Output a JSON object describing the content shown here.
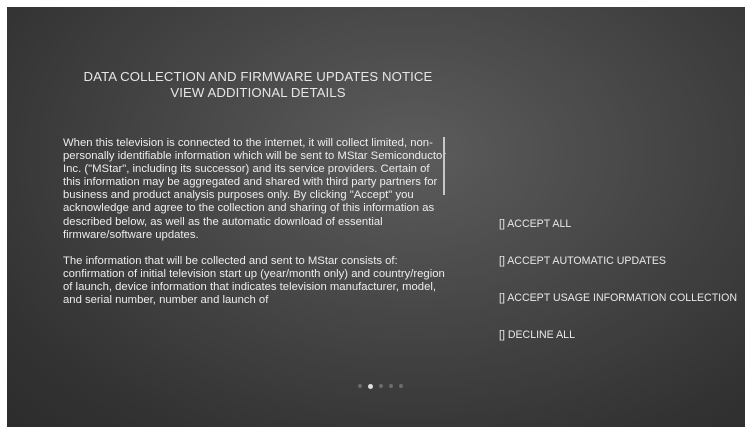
{
  "header": {
    "title_line1": "DATA COLLECTION AND FIRMWARE UPDATES NOTICE",
    "title_line2": "VIEW ADDITIONAL DETAILS"
  },
  "notice": {
    "paragraph1": "When this television is connected to the internet, it will collect limited, non-personally identifiable information which will be sent to MStar Semiconductor Inc. (\"MStar\", including its successor) and its service providers. Certain of this information may be aggregated and shared with third party partners for business and product analysis purposes only. By clicking \"Accept\" you acknowledge and agree to the collection and sharing of this information as described below, as well as the automatic download of essential firmware/software updates.",
    "paragraph2": "The information that will be collected and sent to MStar consists of: confirmation of initial television start up (year/month only) and country/region of launch, device information that indicates television manufacturer, model, and serial number, number and launch of"
  },
  "options": [
    {
      "label": "[] ACCEPT ALL"
    },
    {
      "label": "[] ACCEPT AUTOMATIC UPDATES"
    },
    {
      "label": "[] ACCEPT USAGE INFORMATION COLLECTION"
    },
    {
      "label": "[] DECLINE ALL"
    }
  ],
  "pager": {
    "total": 5,
    "active_index": 1
  },
  "colors": {
    "text": "#e6e6e6",
    "dot_active": "#e0e0e0",
    "dot_inactive": "#6b6b6b"
  }
}
